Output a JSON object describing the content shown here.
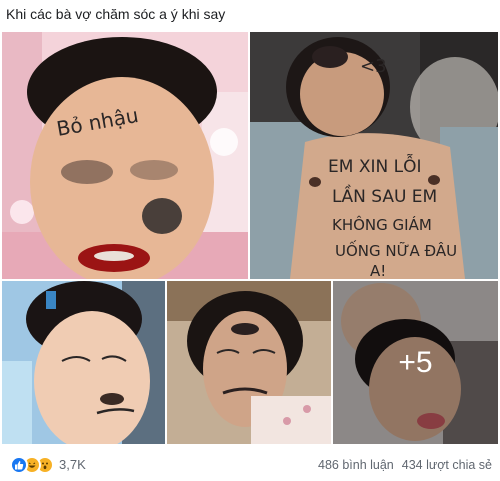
{
  "post": {
    "text": "Khi các bà vợ chăm sóc a ý khi say"
  },
  "photos": {
    "p1_caption": "Bỏ nhậu",
    "p2_mark": "<3",
    "p2_note_lines": [
      "EM XIN LỖI",
      "LẦN SAU EM",
      "KHÔNG GIÁM",
      "UỐNG NỮA ĐÂU",
      "A!"
    ],
    "more_label": "+5"
  },
  "engagement": {
    "reaction_icons": [
      "like-icon",
      "haha-icon",
      "wow-icon"
    ],
    "reaction_count": "3,7K",
    "comments": "486 bình luận",
    "shares": "434 lượt chia sẻ"
  },
  "colors": {
    "like": "#1877f2",
    "haha": "#f7b125",
    "meta_text": "#606770"
  }
}
